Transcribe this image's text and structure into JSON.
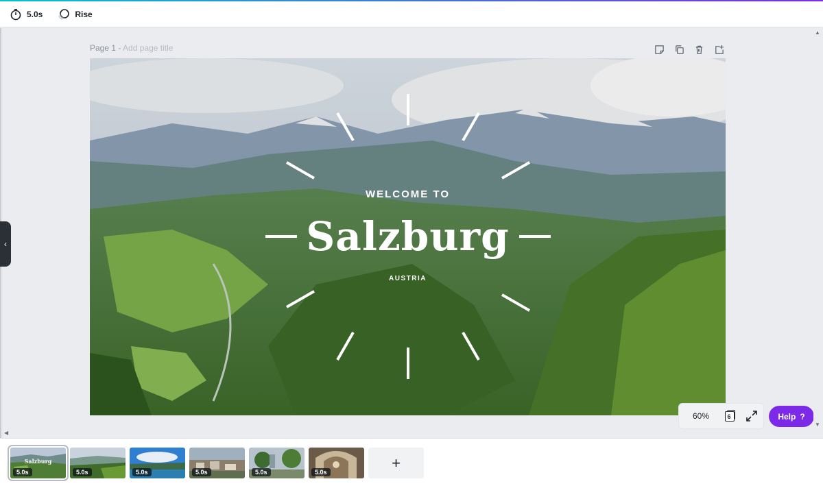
{
  "toolbar": {
    "duration": "5.0s",
    "animation": "Rise"
  },
  "page": {
    "label": "Page 1 -",
    "title_placeholder": "Add page title"
  },
  "design": {
    "welcome": "WELCOME TO",
    "title": "Salzburg",
    "subtitle": "AUSTRIA"
  },
  "zoom": {
    "value": "60%",
    "page_count": "6"
  },
  "help": {
    "label": "Help",
    "icon": "?"
  },
  "thumbnails": [
    {
      "duration": "5.0s",
      "title": "Salzburg"
    },
    {
      "duration": "5.0s"
    },
    {
      "duration": "5.0s"
    },
    {
      "duration": "5.0s"
    },
    {
      "duration": "5.0s"
    },
    {
      "duration": "5.0s"
    }
  ],
  "add_page": "+",
  "colors": {
    "accent": "#7d2ae8",
    "topline_start": "#00c4cc",
    "canvas_bg": "#ebecf0"
  }
}
